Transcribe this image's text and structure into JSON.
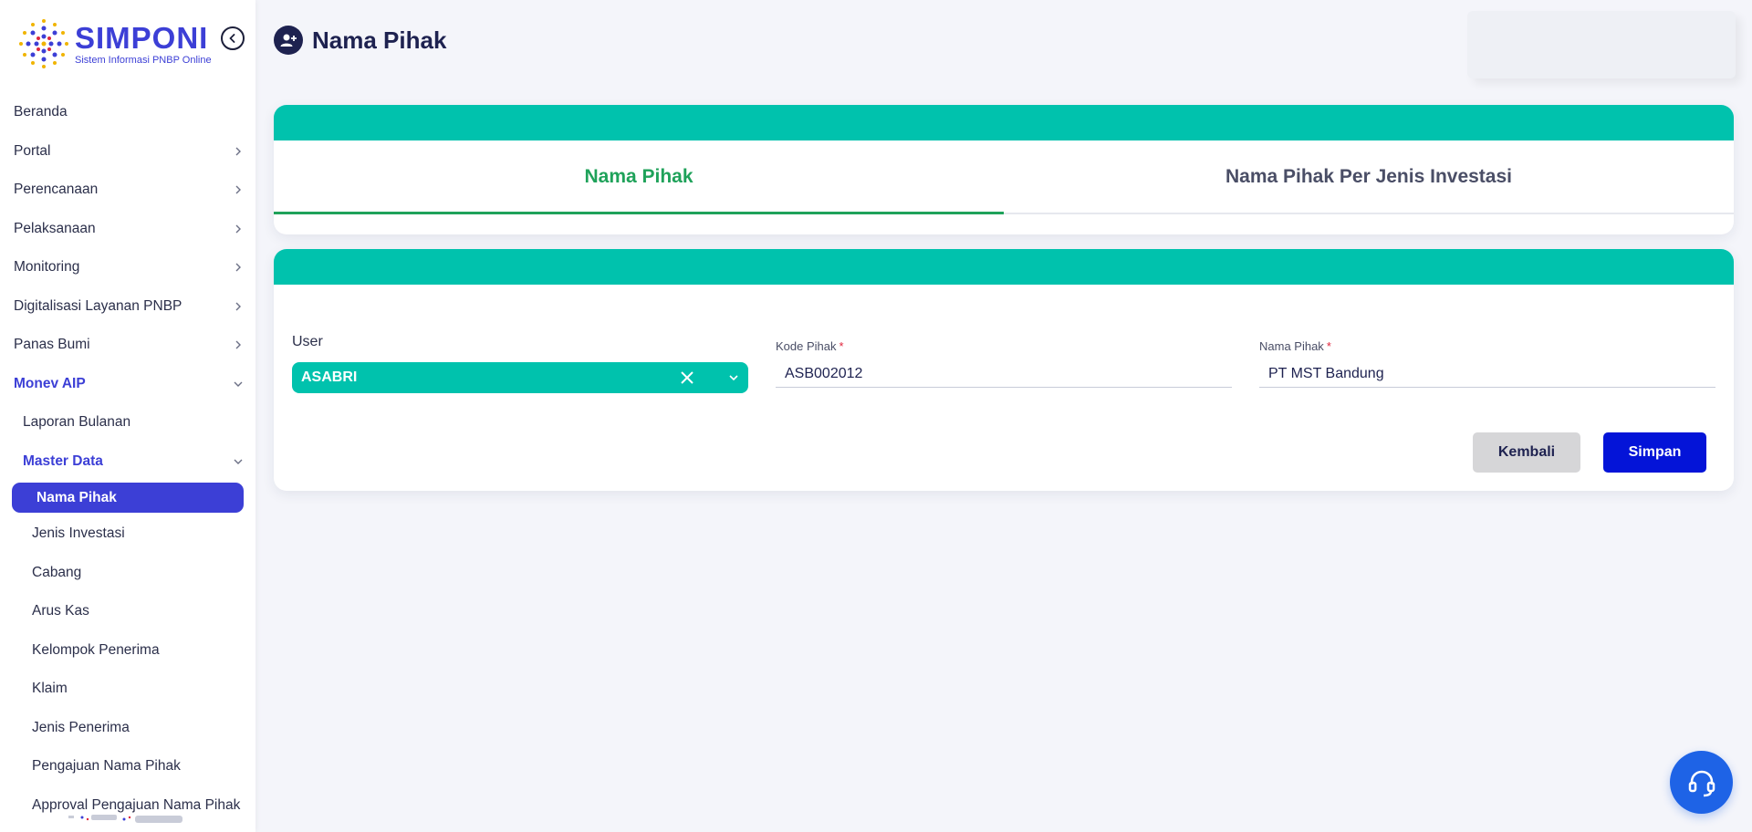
{
  "brand": {
    "name": "SIMPONI",
    "tagline": "Sistem Informasi PNBP Online",
    "color": "#3c3fd6"
  },
  "sidebar": {
    "items": [
      {
        "label": "Beranda",
        "has_children": false
      },
      {
        "label": "Portal",
        "has_children": true
      },
      {
        "label": "Perencanaan",
        "has_children": true
      },
      {
        "label": "Pelaksanaan",
        "has_children": true
      },
      {
        "label": "Monitoring",
        "has_children": true
      },
      {
        "label": "Digitalisasi Layanan PNBP",
        "has_children": true
      },
      {
        "label": "Panas Bumi",
        "has_children": true
      },
      {
        "label": "Monev AIP",
        "has_children": true,
        "expanded": true
      },
      {
        "label": "Laporan Bulanan"
      },
      {
        "label": "Master Data",
        "expanded": true
      },
      {
        "label": "Nama Pihak",
        "selected": true
      },
      {
        "label": "Jenis Investasi"
      },
      {
        "label": "Cabang"
      },
      {
        "label": "Arus Kas"
      },
      {
        "label": "Kelompok Penerima"
      },
      {
        "label": "Klaim"
      },
      {
        "label": "Jenis Penerima"
      },
      {
        "label": "Pengajuan Nama Pihak"
      },
      {
        "label": "Approval Pengajuan Nama Pihak"
      }
    ]
  },
  "header": {
    "title": "Nama Pihak",
    "icon": "user-plus-icon"
  },
  "tabs": [
    {
      "label": "Nama Pihak",
      "active": true
    },
    {
      "label": "Nama Pihak Per Jenis Investasi",
      "active": false
    }
  ],
  "form": {
    "user": {
      "label": "User",
      "value": "ASABRI"
    },
    "kode_pihak": {
      "label": "Kode Pihak",
      "required_mark": "*",
      "value": "ASB002012"
    },
    "nama_pihak": {
      "label": "Nama Pihak",
      "required_mark": "*",
      "value": "PT MST Bandung"
    },
    "buttons": {
      "back": "Kembali",
      "save": "Simpan"
    }
  },
  "colors": {
    "accent_teal": "#00c2ad",
    "tab_active_green": "#1fa25a",
    "primary_blue": "#0414d8",
    "sidebar_selected": "#3c3fd6"
  }
}
